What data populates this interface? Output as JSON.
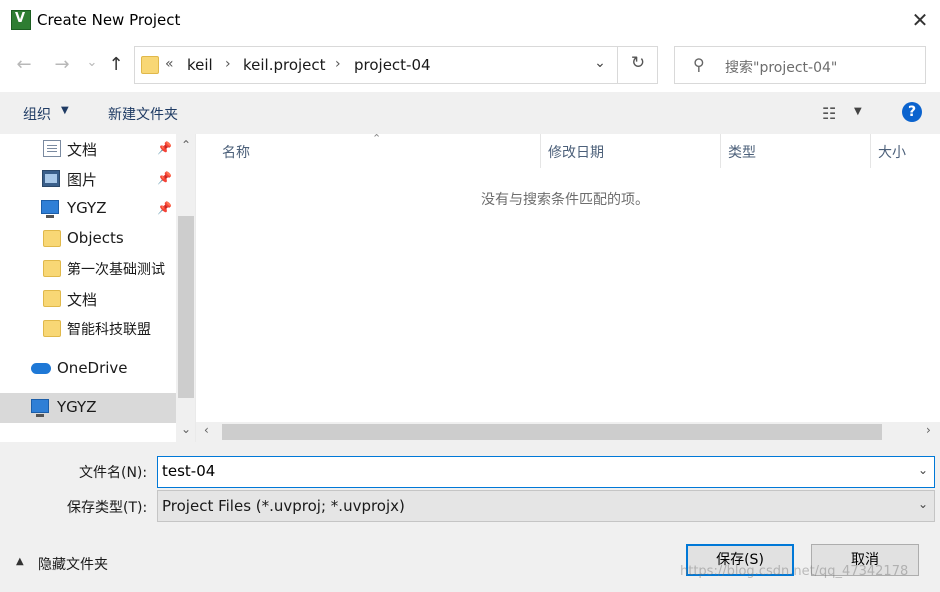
{
  "window": {
    "title": "Create New Project",
    "close_glyph": "✕"
  },
  "nav": {
    "back_glyph": "←",
    "forward_glyph": "→",
    "history_glyph": "⌄",
    "up_glyph": "↑",
    "breadcrumb_prefix": "«",
    "breadcrumbs": [
      "keil",
      "keil.project",
      "project-04"
    ],
    "crumb_separator": "›",
    "dropdown_glyph": "⌄",
    "refresh_glyph": "↻",
    "search_placeholder": "搜索\"project-04\"",
    "search_glyph": "⚲"
  },
  "toolbar": {
    "organize_label": "组织",
    "organize_caret": "▼",
    "new_folder_label": "新建文件夹",
    "view_glyph": "☷",
    "view_caret": "▼",
    "help_glyph": "?"
  },
  "sidebar": {
    "items": [
      {
        "label": "文档",
        "icon": "document-icon",
        "pinned": true
      },
      {
        "label": "图片",
        "icon": "picture-icon",
        "pinned": true
      },
      {
        "label": "YGYZ",
        "icon": "computer-icon",
        "pinned": true
      },
      {
        "label": "Objects",
        "icon": "folder-icon",
        "pinned": false
      },
      {
        "label": "第一次基础测试",
        "icon": "folder-icon",
        "pinned": false
      },
      {
        "label": "文档",
        "icon": "folder-icon",
        "pinned": false
      },
      {
        "label": "智能科技联盟",
        "icon": "folder-icon",
        "pinned": false
      },
      {
        "label": "OneDrive",
        "icon": "onedrive-icon",
        "pinned": false
      },
      {
        "label": "YGYZ",
        "icon": "computer-icon",
        "pinned": false,
        "selected": true
      }
    ],
    "pin_glyph": "📌",
    "scroll_up_glyph": "⌃",
    "scroll_down_glyph": "⌄"
  },
  "filelist": {
    "columns": [
      "名称",
      "修改日期",
      "类型",
      "大小"
    ],
    "sort_glyph": "⌃",
    "empty_message": "没有与搜索条件匹配的项。",
    "scroll_left_glyph": "‹",
    "scroll_right_glyph": "›"
  },
  "form": {
    "filename_label": "文件名(N):",
    "filename_value": "test-04",
    "filetype_label": "保存类型(T):",
    "filetype_value": "Project Files (*.uvproj; *.uvprojx)",
    "dropdown_glyph": "⌄",
    "hide_folders_label": "隐藏文件夹",
    "hide_folders_caret": "▲",
    "save_label": "保存(S)",
    "cancel_label": "取消"
  },
  "watermark": "https://blog.csdn.net/qq_47342178"
}
